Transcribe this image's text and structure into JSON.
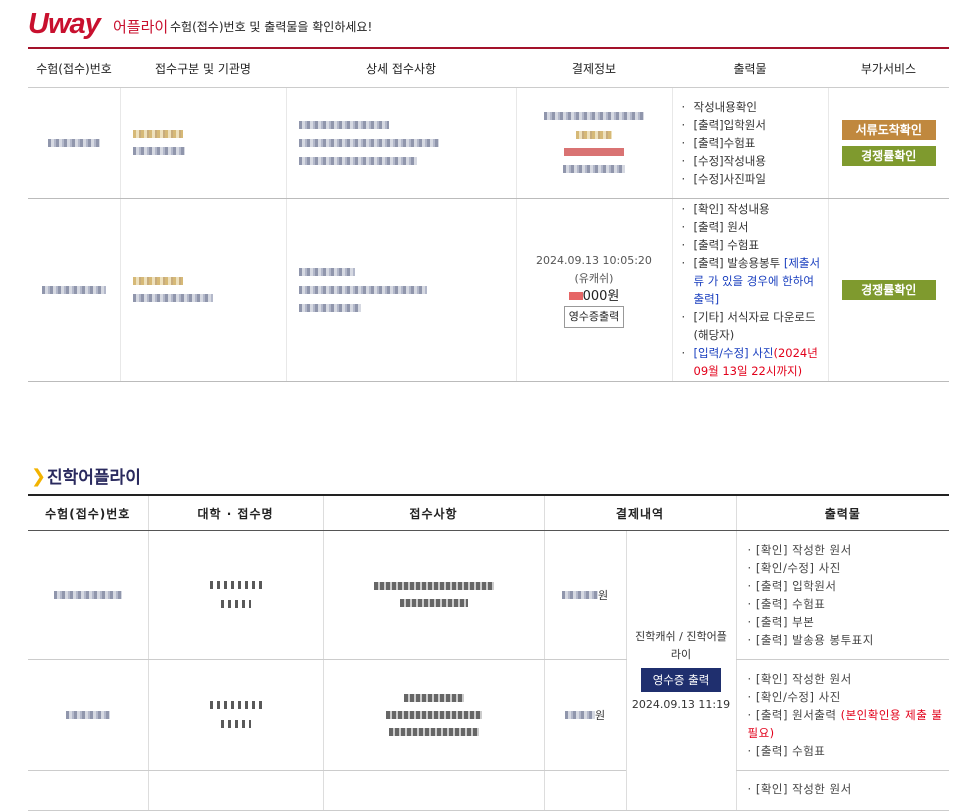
{
  "header": {
    "logo": "Uway",
    "brand": "어플라이",
    "notice": "수험(접수)번호 및 출력물을 확인하세요!"
  },
  "table1": {
    "headers": [
      "수험(접수)번호",
      "접수구분 및 기관명",
      "상세 접수사항",
      "결제정보",
      "출력물",
      "부가서비스"
    ],
    "row1": {
      "prints": [
        "작성내용확인",
        "[출력]입학원서",
        "[출력]수험표",
        "[수정]작성내용",
        "[수정]사진파일"
      ],
      "services": [
        "서류도착확인",
        "경쟁률확인"
      ]
    },
    "row2": {
      "pay_date": "2024.09.13 10:05:20",
      "pay_method": "(유캐쉬)",
      "pay_amount": "000원",
      "receipt_btn": "영수증출력",
      "prints": [
        {
          "text": "[확인] 작성내용"
        },
        {
          "text": "[출력] 원서"
        },
        {
          "text": "[출력] 수험표"
        },
        {
          "text": "[출력] 발송용봉투 ",
          "blue": "[제출서류 가 있을 경우에 한하여 출력]"
        },
        {
          "text": "[기타] 서식자료 다운로드(해당자)"
        },
        {
          "text": "",
          "blue": "[입력/수정] 사진",
          "red": "(2024년 09월 13일 22시까지)"
        }
      ],
      "services": [
        "경쟁률확인"
      ]
    }
  },
  "section2": {
    "title": "진학어플라이",
    "headers": [
      "수험(접수)번호",
      "대학 · 접수명",
      "접수사항",
      "결제내역",
      "출력물"
    ],
    "row1": {
      "pay": "원",
      "prints": [
        "· [확인] 작성한 원서",
        "· [확인/수정] 사진",
        "· [출력] 입학원서",
        "· [출력] 수험표",
        "· [출력] 부본",
        "· [출력] 발송용 봉투표지"
      ]
    },
    "row2": {
      "pay": "원",
      "pay_info": "진학캐쉬 / 진학어플라이",
      "receipt_btn": "영수증 출력",
      "receipt_date": "2024.09.13 11:19",
      "prints": [
        "· [확인] 작성한 원서",
        "· [확인/수정] 사진",
        "· [출력] 원서출력",
        "· [출력] 수험표"
      ],
      "print_red": "(본인확인용 제출 불필요)"
    },
    "row3": {
      "prints": [
        "· [확인] 작성한 원서"
      ]
    }
  },
  "colors": {
    "accent": "#c8102e",
    "gold_button": "#c0883e",
    "green_button": "#7f9a2e",
    "navy": "#1f2f6e"
  }
}
